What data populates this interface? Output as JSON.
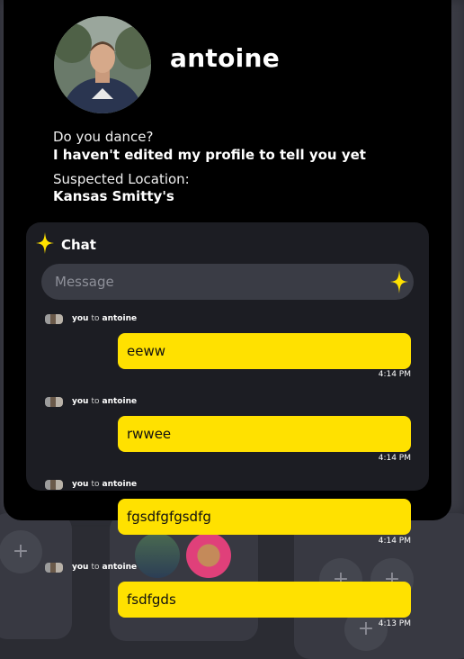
{
  "profile": {
    "name": "antoine",
    "question_label": "Do you dance?",
    "question_answer": "I haven't edited my profile to tell you yet",
    "location_label": "Suspected Location:",
    "location_value": "Kansas Smitty's"
  },
  "chat": {
    "title": "Chat",
    "input_placeholder": "Message",
    "messages": [
      {
        "from": "you",
        "to_word": "to",
        "recipient": "antoine",
        "text": "eeww",
        "time": "4:14 PM"
      },
      {
        "from": "you",
        "to_word": "to",
        "recipient": "antoine",
        "text": "rwwee",
        "time": "4:14 PM"
      },
      {
        "from": "you",
        "to_word": "to",
        "recipient": "antoine",
        "text": "fgsdfgfgsdfg",
        "time": "4:14 PM"
      },
      {
        "from": "you",
        "to_word": "to",
        "recipient": "antoine",
        "text": "fsdfgds",
        "time": "4:13 PM"
      }
    ]
  },
  "background": {
    "plus_symbol": "+"
  },
  "colors": {
    "bubble": "#ffe100",
    "panel": "#000000",
    "chat_card": "#1c1d23",
    "sparkle": "#ffe100"
  }
}
